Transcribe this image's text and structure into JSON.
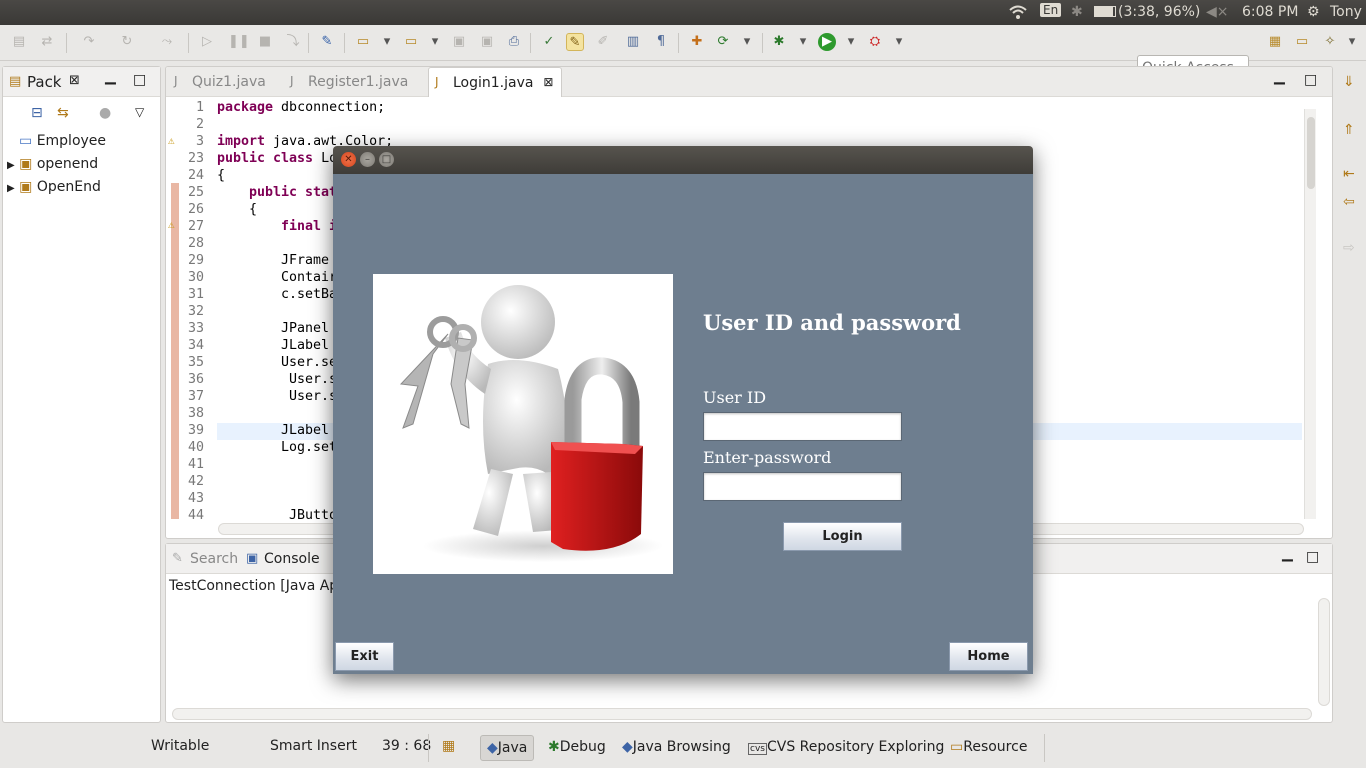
{
  "panel": {
    "keyboard": "En",
    "battery": "(3:38, 96%)",
    "time": "6:08 PM",
    "user": "Tony"
  },
  "toolbar": {
    "quick_access_placeholder": "Quick Access"
  },
  "package_view": {
    "title": "Pack",
    "items": [
      {
        "label": "Employee",
        "expandable": false
      },
      {
        "label": "openend",
        "expandable": true
      },
      {
        "label": "OpenEnd",
        "expandable": true
      }
    ]
  },
  "editor": {
    "tabs": [
      {
        "label": "Quiz1.java",
        "active": false
      },
      {
        "label": "Register1.java",
        "active": false
      },
      {
        "label": "Login1.java",
        "active": true
      }
    ],
    "lines": [
      {
        "n": "1",
        "kw": "package",
        "text": " dbconnection;",
        "indent": 0
      },
      {
        "n": "2",
        "kw": "",
        "text": "",
        "indent": 0
      },
      {
        "n": "3",
        "kw": "import",
        "text": " java.awt.Color;",
        "indent": 0
      },
      {
        "n": "23",
        "kw": "public class",
        "text": " Lo",
        "indent": 0
      },
      {
        "n": "24",
        "kw": "",
        "text": "{",
        "indent": 0
      },
      {
        "n": "25",
        "kw": "public stat",
        "text": "",
        "indent": 4
      },
      {
        "n": "26",
        "kw": "",
        "text": "{",
        "indent": 4
      },
      {
        "n": "27",
        "kw": "final i",
        "text": "",
        "indent": 8
      },
      {
        "n": "28",
        "kw": "",
        "text": "",
        "indent": 0
      },
      {
        "n": "29",
        "kw": "",
        "text": "JFrame",
        "indent": 8
      },
      {
        "n": "30",
        "kw": "",
        "text": "Contair",
        "indent": 8
      },
      {
        "n": "31",
        "kw": "",
        "text": "c.setBa",
        "indent": 8
      },
      {
        "n": "32",
        "kw": "",
        "text": "",
        "indent": 0
      },
      {
        "n": "33",
        "kw": "",
        "text": "JPanel",
        "indent": 8
      },
      {
        "n": "34",
        "kw": "",
        "text": "JLabel",
        "indent": 8
      },
      {
        "n": "35",
        "kw": "",
        "text": "User.se",
        "indent": 8
      },
      {
        "n": "36",
        "kw": "",
        "text": " User.s",
        "indent": 8
      },
      {
        "n": "37",
        "kw": "",
        "text": " User.s",
        "indent": 8
      },
      {
        "n": "38",
        "kw": "",
        "text": "",
        "indent": 0
      },
      {
        "n": "39",
        "kw": "",
        "text": "JLabel",
        "indent": 8
      },
      {
        "n": "40",
        "kw": "",
        "text": "Log.set",
        "indent": 8
      },
      {
        "n": "41",
        "kw": "",
        "text": "",
        "indent": 0
      },
      {
        "n": "42",
        "kw": "",
        "text": "",
        "indent": 0
      },
      {
        "n": "43",
        "kw": "",
        "text": "",
        "indent": 0
      },
      {
        "n": "44",
        "kw": "",
        "text": " JButto",
        "indent": 8
      }
    ]
  },
  "bottom_view": {
    "tabs": [
      {
        "label": "Search",
        "active": false
      },
      {
        "label": "Console",
        "active": true
      }
    ],
    "console_text": "TestConnection [Java Ap"
  },
  "status": {
    "writable": "Writable",
    "insert_mode": "Smart Insert",
    "position": "39 : 68"
  },
  "perspectives": [
    {
      "label": "Java",
      "icon": "java-perspective-icon",
      "active": true
    },
    {
      "label": "Debug",
      "icon": "bug-icon",
      "active": false
    },
    {
      "label": "Java Browsing",
      "icon": "java-browsing-icon",
      "active": false
    },
    {
      "label": "CVS Repository Exploring",
      "icon": "cvs-icon",
      "active": false
    },
    {
      "label": "Resource",
      "icon": "resource-icon",
      "active": false
    }
  ],
  "dialog": {
    "heading": "User ID and password",
    "user_id_label": "User ID",
    "user_id_value": "",
    "password_label": "Enter-password",
    "password_value": "",
    "login_label": "Login",
    "exit_label": "Exit",
    "home_label": "Home",
    "background_color": "#6e7e8f"
  }
}
